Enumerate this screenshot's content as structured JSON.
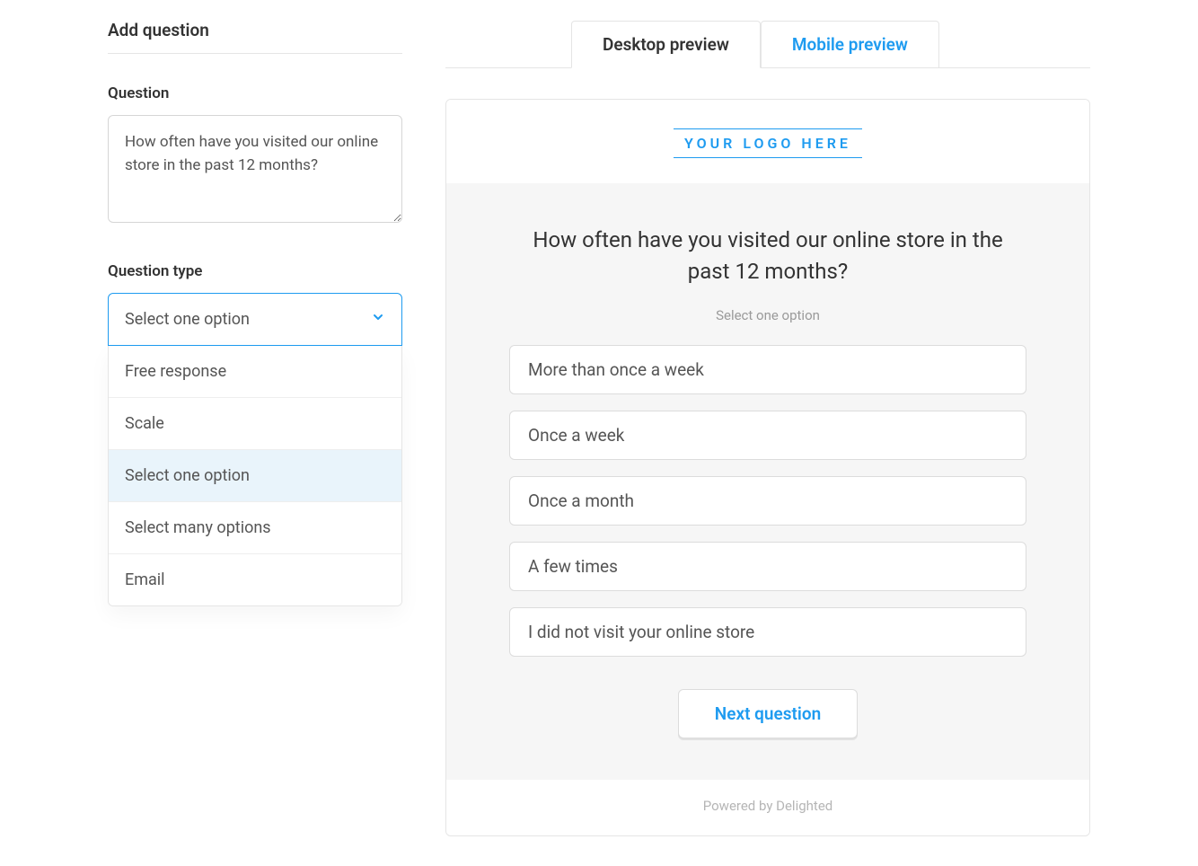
{
  "left": {
    "title": "Add question",
    "question_label": "Question",
    "question_value": "How often have you visited our online store in the past 12 months?",
    "type_label": "Question type",
    "type_selected": "Select one option",
    "type_options": [
      {
        "label": "Free response",
        "active": false
      },
      {
        "label": "Scale",
        "active": false
      },
      {
        "label": "Select one option",
        "active": true
      },
      {
        "label": "Select many options",
        "active": false
      },
      {
        "label": "Email",
        "active": false
      }
    ]
  },
  "tabs": {
    "desktop": "Desktop preview",
    "mobile": "Mobile preview"
  },
  "preview": {
    "logo_text": "YOUR LOGO HERE",
    "question": "How often have you visited our online store in the past 12 months?",
    "instruction": "Select one option",
    "options": [
      "More than once a week",
      "Once a week",
      "Once a month",
      "A few times",
      "I did not visit your online store"
    ],
    "next_label": "Next question",
    "footer": "Powered by Delighted"
  }
}
